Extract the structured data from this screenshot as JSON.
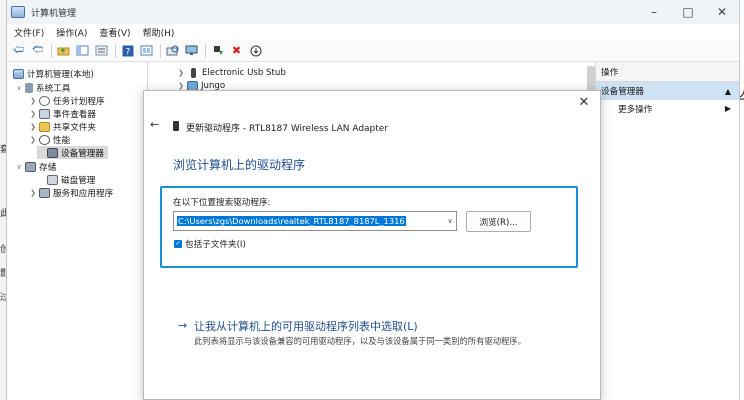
{
  "bg_left_chars": [
    "套",
    "此",
    "浏",
    "创",
    "影",
    "过"
  ],
  "bg_right_char": "亾",
  "window": {
    "title": "计算机管理"
  },
  "menu": {
    "file": "文件(F)",
    "action": "操作(A)",
    "view": "查看(V)",
    "help": "帮助(H)"
  },
  "tree": {
    "root": "计算机管理(本地)",
    "system_tools": "系统工具",
    "task_scheduler": "任务计划程序",
    "event_viewer": "事件查看器",
    "shared_folders": "共享文件夹",
    "performance": "性能",
    "device_manager": "设备管理器",
    "storage": "存储",
    "disk_management": "磁盘管理",
    "services": "服务和应用程序"
  },
  "device_list": [
    "Electronic Usb Stub",
    "Jungo"
  ],
  "actions": {
    "header": "操作",
    "selected": "设备管理器",
    "more": "更多操作"
  },
  "dialog": {
    "title": "更新驱动程序 - RTL8187 Wireless LAN Adapter",
    "heading": "浏览计算机上的驱动程序",
    "search_label": "在以下位置搜索驱动程序:",
    "path_value": "C:\\Users\\zgs\\Downloads\\realtek_RTL8187_8187L_1316",
    "browse_label": "浏览(R)...",
    "include_subfolders": "包括子文件夹(I)",
    "include_subfolders_checked": true,
    "pick_link": "让我从计算机上的可用驱动程序列表中选取(L)",
    "pick_desc": "此列表将显示与该设备兼容的可用驱动程序，以及与该设备属于同一类别的所有驱动程序。"
  },
  "colors": {
    "accent": "#0078d7",
    "focus_border": "#1a8fd6",
    "link": "#1f4e8c",
    "selection": "#cde3f4"
  }
}
